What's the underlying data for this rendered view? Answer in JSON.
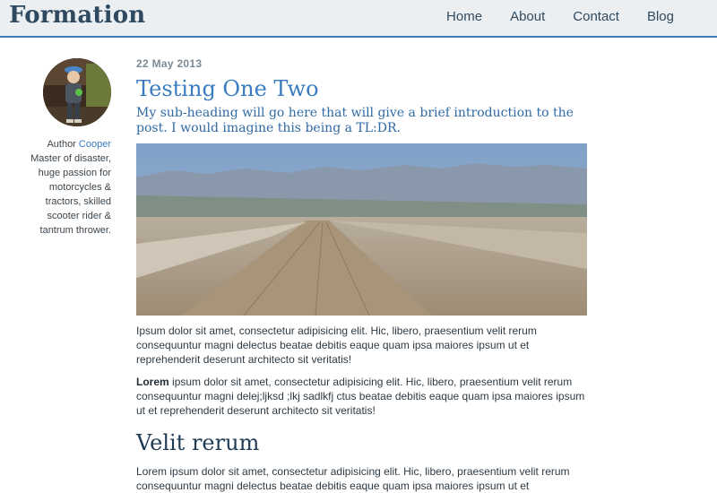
{
  "site": {
    "brand": "Formation",
    "nav": [
      "Home",
      "About",
      "Contact",
      "Blog"
    ]
  },
  "author": {
    "prefix": "Author",
    "name": "Cooper",
    "bio": "Master of disaster, huge passion for motorcycles & tractors, skilled scooter rider & tantrum thrower."
  },
  "post": {
    "date": "22 May 2013",
    "title": "Testing One Two",
    "subheading": "My sub-heading will go here that will give a brief introduction to the post.  I would imagine this being a TL:DR.",
    "paragraph1": "Ipsum dolor sit amet, consectetur adipisicing elit. Hic, libero, praesentium velit rerum consequuntur magni delectus beatae debitis eaque quam ipsa maiores ipsum ut et reprehenderit deserunt architecto sit veritatis!",
    "paragraph2_bold": "Lorem",
    "paragraph2_rest": " ipsum dolor sit amet, consectetur adipisicing elit. Hic, libero, praesentium velit rerum consequuntur magni delej;ljksd ;lkj sadlkfj ctus beatae debitis eaque quam ipsa maiores ipsum ut et reprehenderit deserunt architecto sit veritatis!",
    "section_heading": "Velit rerum",
    "paragraph3": "Lorem ipsum dolor sit amet, consectetur adipisicing elit. Hic, libero, praesentium velit rerum consequuntur magni delectus beatae debitis eaque quam ipsa maiores ipsum ut et"
  }
}
